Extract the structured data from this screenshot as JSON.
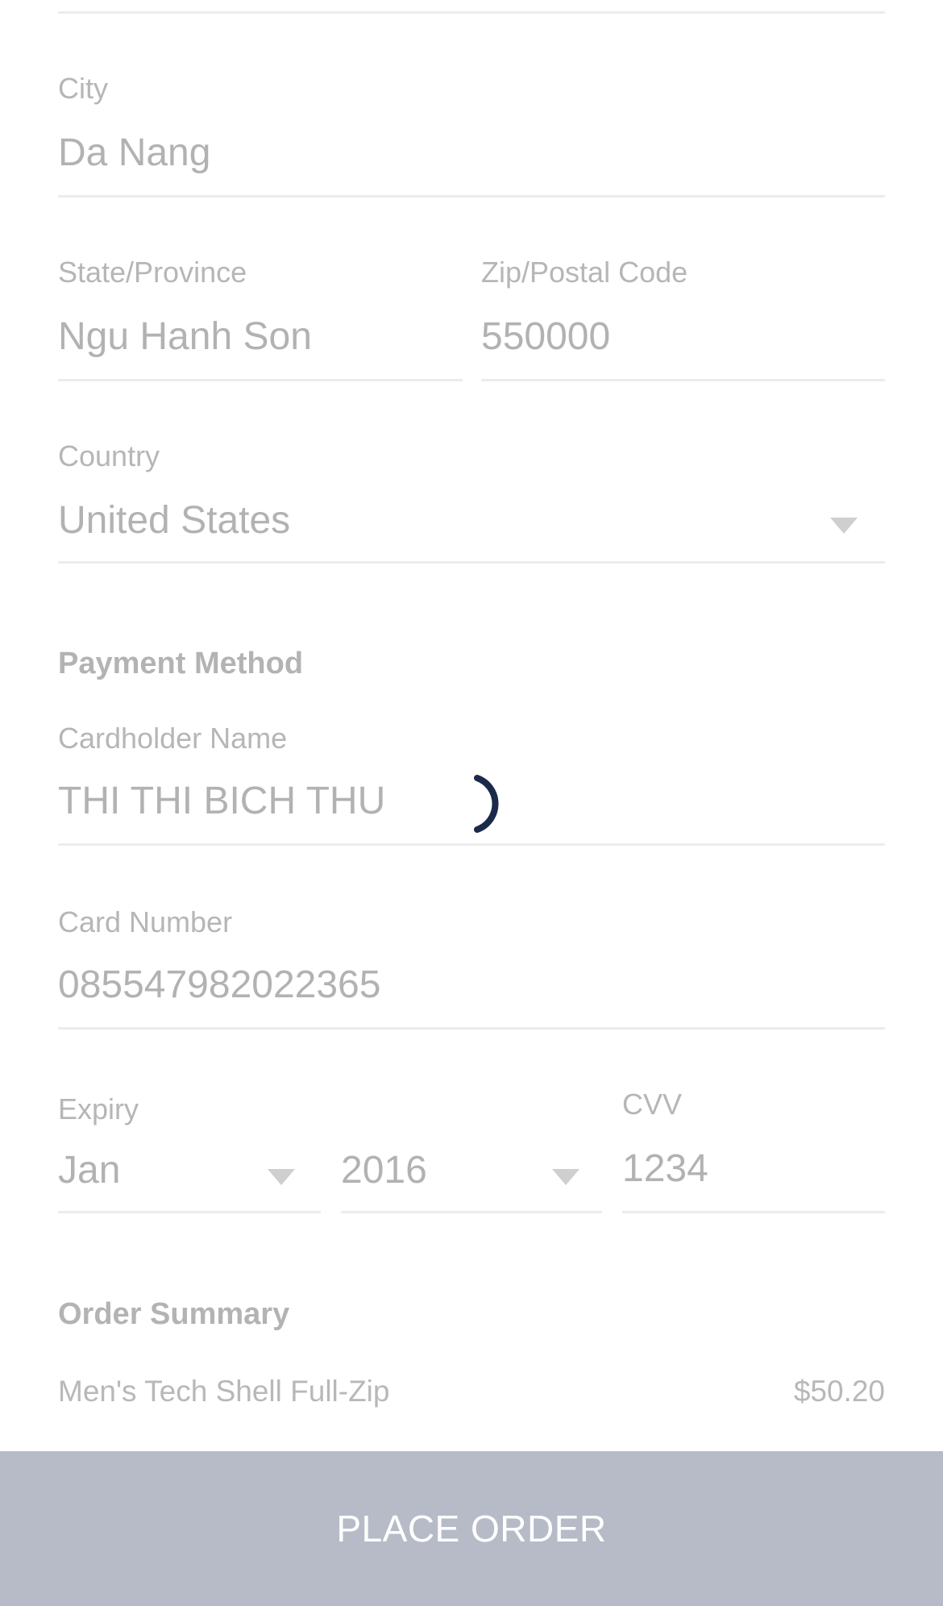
{
  "address": {
    "city": {
      "label": "City",
      "value": "Da Nang"
    },
    "state": {
      "label": "State/Province",
      "value": "Ngu Hanh Son"
    },
    "zip": {
      "label": "Zip/Postal Code",
      "value": "550000"
    },
    "country": {
      "label": "Country",
      "value": "United States"
    }
  },
  "payment": {
    "title": "Payment Method",
    "cardholder": {
      "label": "Cardholder Name",
      "value": "THI THI BICH THU"
    },
    "card_number": {
      "label": "Card Number",
      "value": "085547982022365"
    },
    "expiry": {
      "label": "Expiry",
      "month": "Jan",
      "year": "2016"
    },
    "cvv": {
      "label": "CVV",
      "value": "1234"
    }
  },
  "order_summary": {
    "title": "Order Summary",
    "items": [
      {
        "name": "Men's Tech Shell Full-Zip",
        "price": "$50.20"
      }
    ]
  },
  "actions": {
    "place_order_label": "PLACE ORDER"
  },
  "colors": {
    "accent": "#1b2a4a",
    "button_bg": "#b6bbc7",
    "text_muted": "#b6b6b6",
    "divider": "#ececec"
  },
  "icons": {
    "select_caret": "chevron-down-icon",
    "loading": "loading-spinner-icon"
  }
}
